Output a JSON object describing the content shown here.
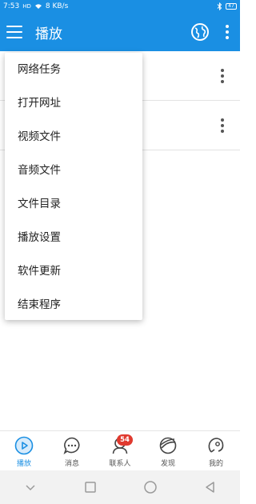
{
  "status_bar": {
    "time": "7:53",
    "signal": "HD",
    "speed": "8 KB/s",
    "battery": "47",
    "bluetooth_icon": "bluetooth-icon"
  },
  "app_bar": {
    "title": "播放",
    "menu_icon": "hamburger-icon",
    "globe_icon": "globe-icon",
    "more_icon": "more-vert-icon"
  },
  "dropdown_menu": {
    "items": [
      {
        "label": "网络任务"
      },
      {
        "label": "打开网址"
      },
      {
        "label": "视频文件"
      },
      {
        "label": "音频文件"
      },
      {
        "label": "文件目录"
      },
      {
        "label": "播放设置"
      },
      {
        "label": "软件更新"
      },
      {
        "label": "结束程序"
      }
    ]
  },
  "tab_bar": {
    "tabs": [
      {
        "label": "播放",
        "icon": "play-icon",
        "active": true
      },
      {
        "label": "消息",
        "icon": "chat-icon"
      },
      {
        "label": "联系人",
        "icon": "contacts-icon",
        "badge": "54"
      },
      {
        "label": "发现",
        "icon": "discover-icon"
      },
      {
        "label": "我的",
        "icon": "profile-icon"
      }
    ]
  },
  "colors": {
    "primary": "#1a8fe3",
    "badge": "#e03a2f"
  }
}
